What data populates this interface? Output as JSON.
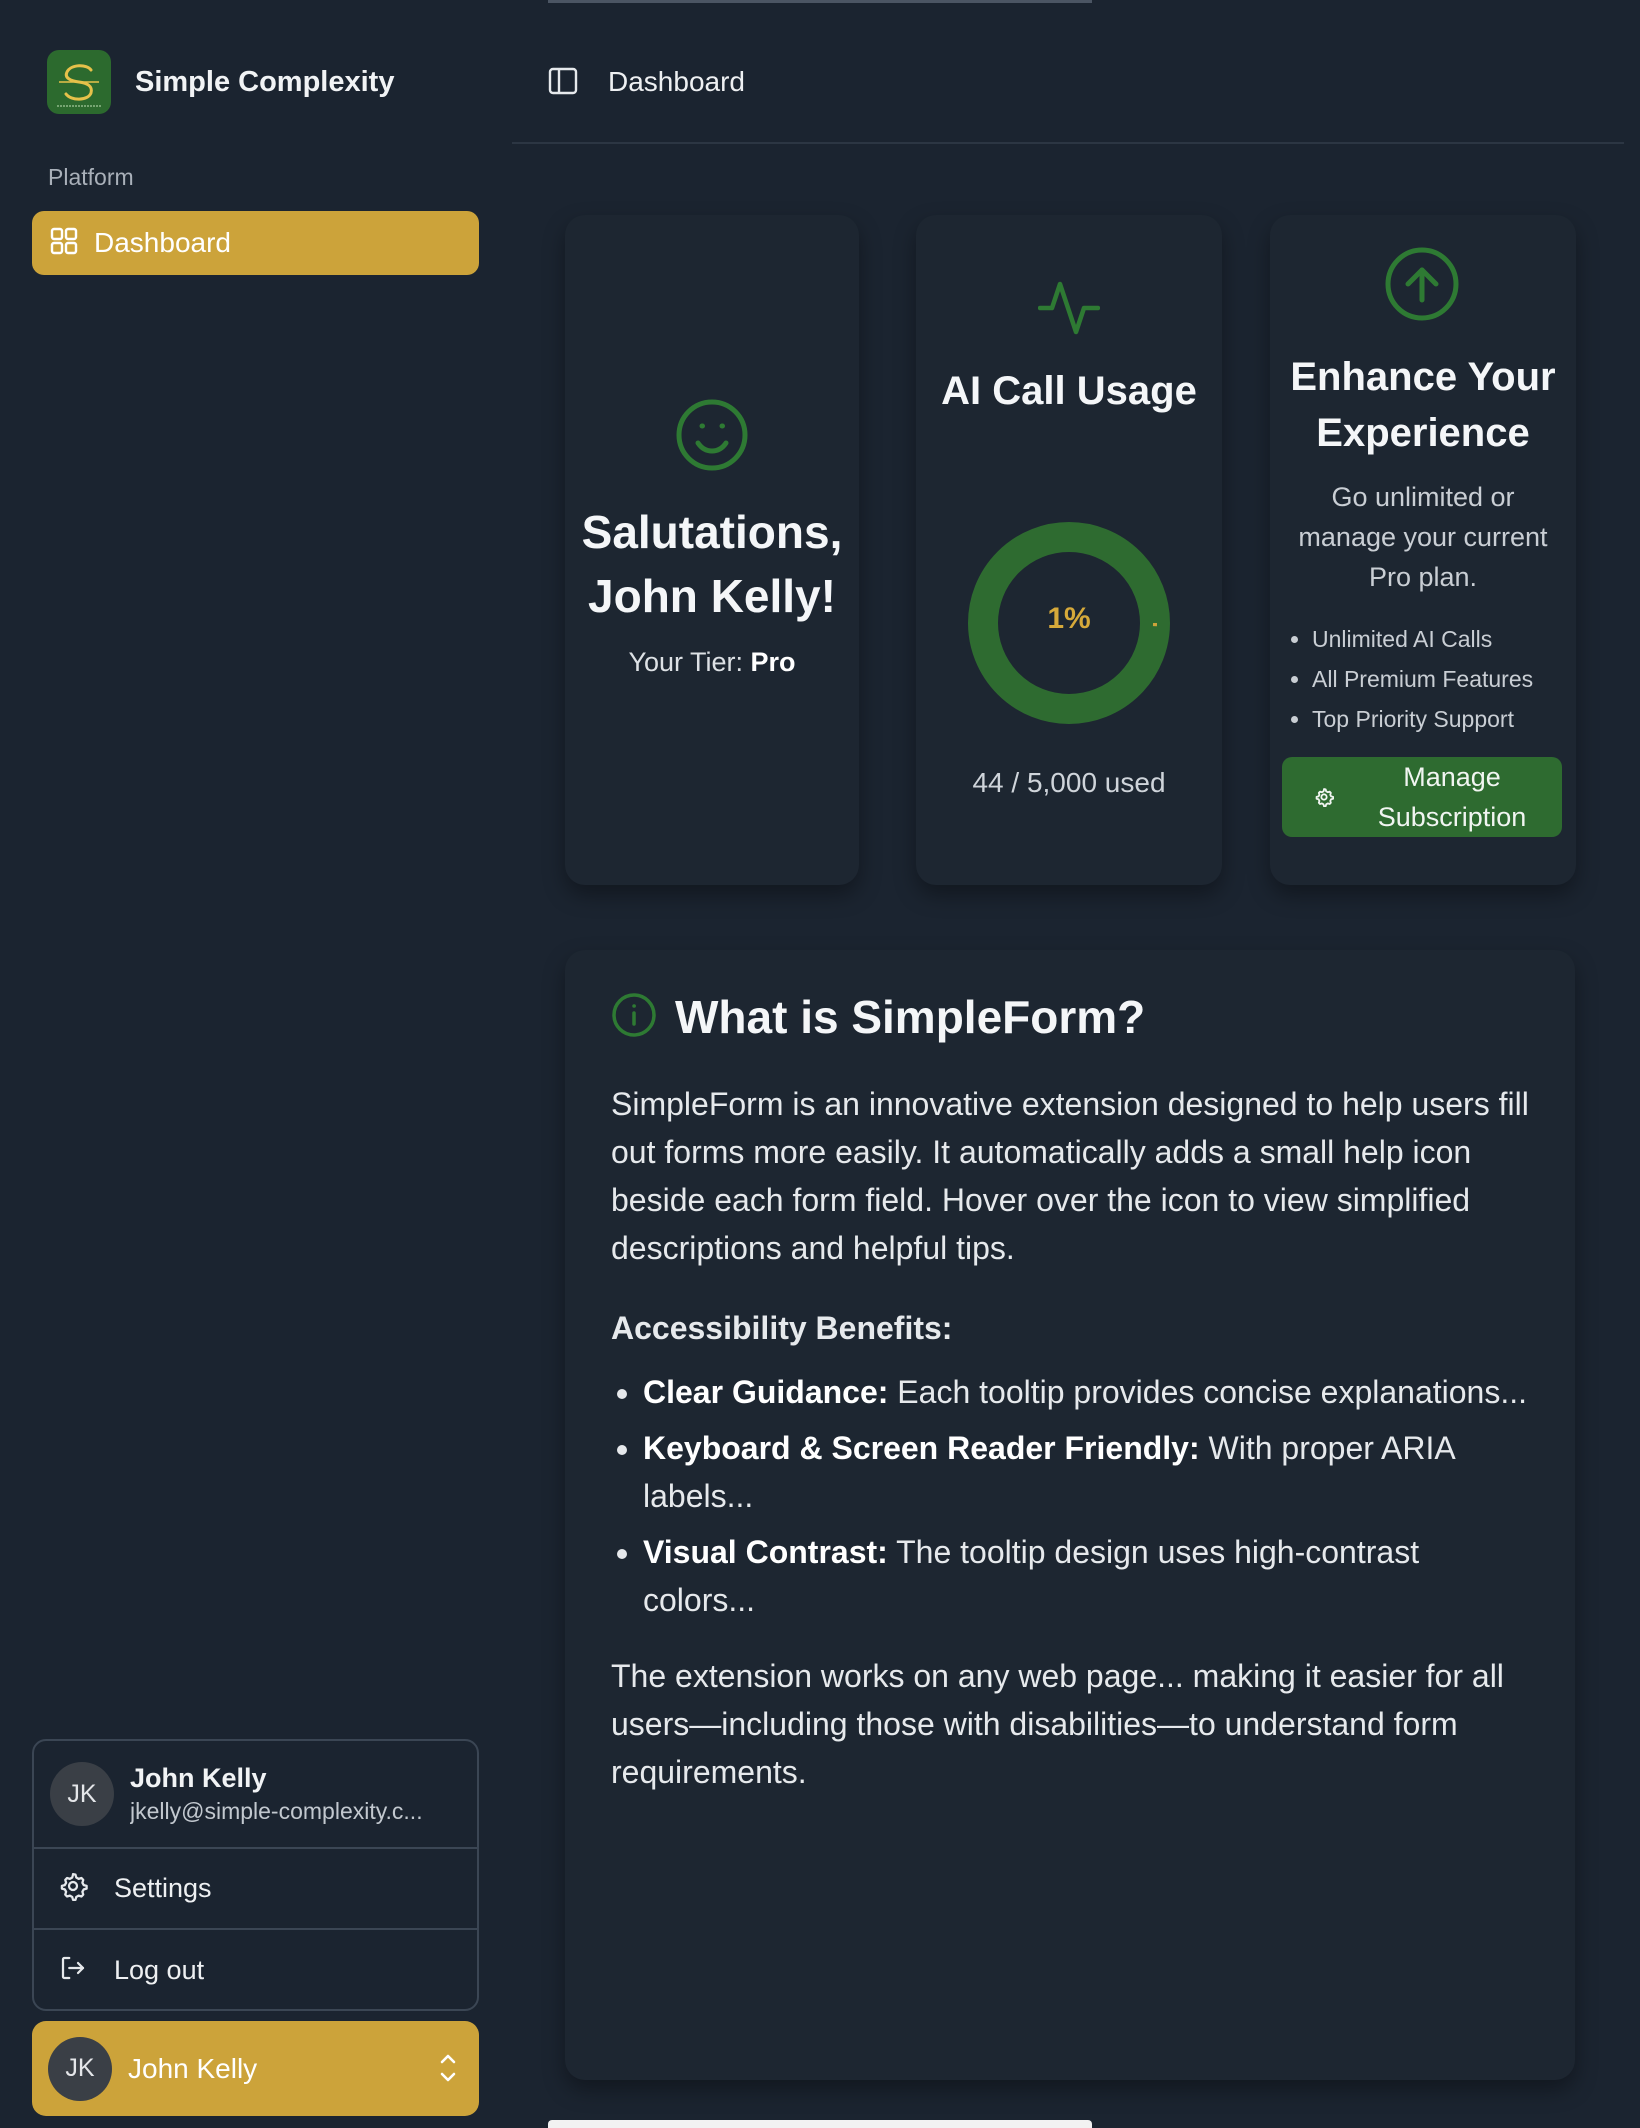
{
  "brand": {
    "name": "Simple Complexity"
  },
  "sidebar": {
    "section_label": "Platform",
    "items": [
      {
        "label": "Dashboard",
        "icon": "grid-icon",
        "active": true
      }
    ]
  },
  "user_menu": {
    "initials": "JK",
    "name": "John Kelly",
    "email": "jkelly@simple-complexity.c...",
    "settings_label": "Settings",
    "logout_label": "Log out"
  },
  "user_switcher": {
    "initials": "JK",
    "name": "John Kelly"
  },
  "header": {
    "title": "Dashboard"
  },
  "welcome_card": {
    "greeting": "Salutations, John Kelly!",
    "tier_label": "Your Tier:",
    "tier_value": "Pro"
  },
  "usage_card": {
    "title": "AI Call Usage",
    "percent_label": "1%",
    "used": 44,
    "limit": 5000,
    "used_fraction": 0.0088,
    "count_text": "44 / 5,000 used"
  },
  "upgrade_card": {
    "title": "Enhance Your Experience",
    "description": "Go unlimited or manage your current Pro plan.",
    "features": [
      "Unlimited AI Calls",
      "All Premium Features",
      "Top Priority Support"
    ],
    "button_label": "Manage Subscription"
  },
  "info": {
    "heading": "What is SimpleForm?",
    "intro": "SimpleForm is an innovative extension designed to help users fill out forms more easily. It automatically adds a small help icon beside each form field. Hover over the icon to view simplified descriptions and helpful tips.",
    "benefits_heading": "Accessibility Benefits:",
    "benefits": [
      {
        "title": "Clear Guidance:",
        "text": " Each tooltip provides concise explanations..."
      },
      {
        "title": "Keyboard & Screen Reader Friendly:",
        "text": " With proper ARIA labels..."
      },
      {
        "title": "Visual Contrast:",
        "text": " The tooltip design uses high-contrast colors..."
      }
    ],
    "closing": "The extension works on any web page... making it easier for all users—including those with disabilities—to understand form requirements."
  },
  "colors": {
    "accent": "#cca33a",
    "brand_green": "#2e6b30",
    "background": "#1b2430",
    "card": "#1d2631"
  }
}
